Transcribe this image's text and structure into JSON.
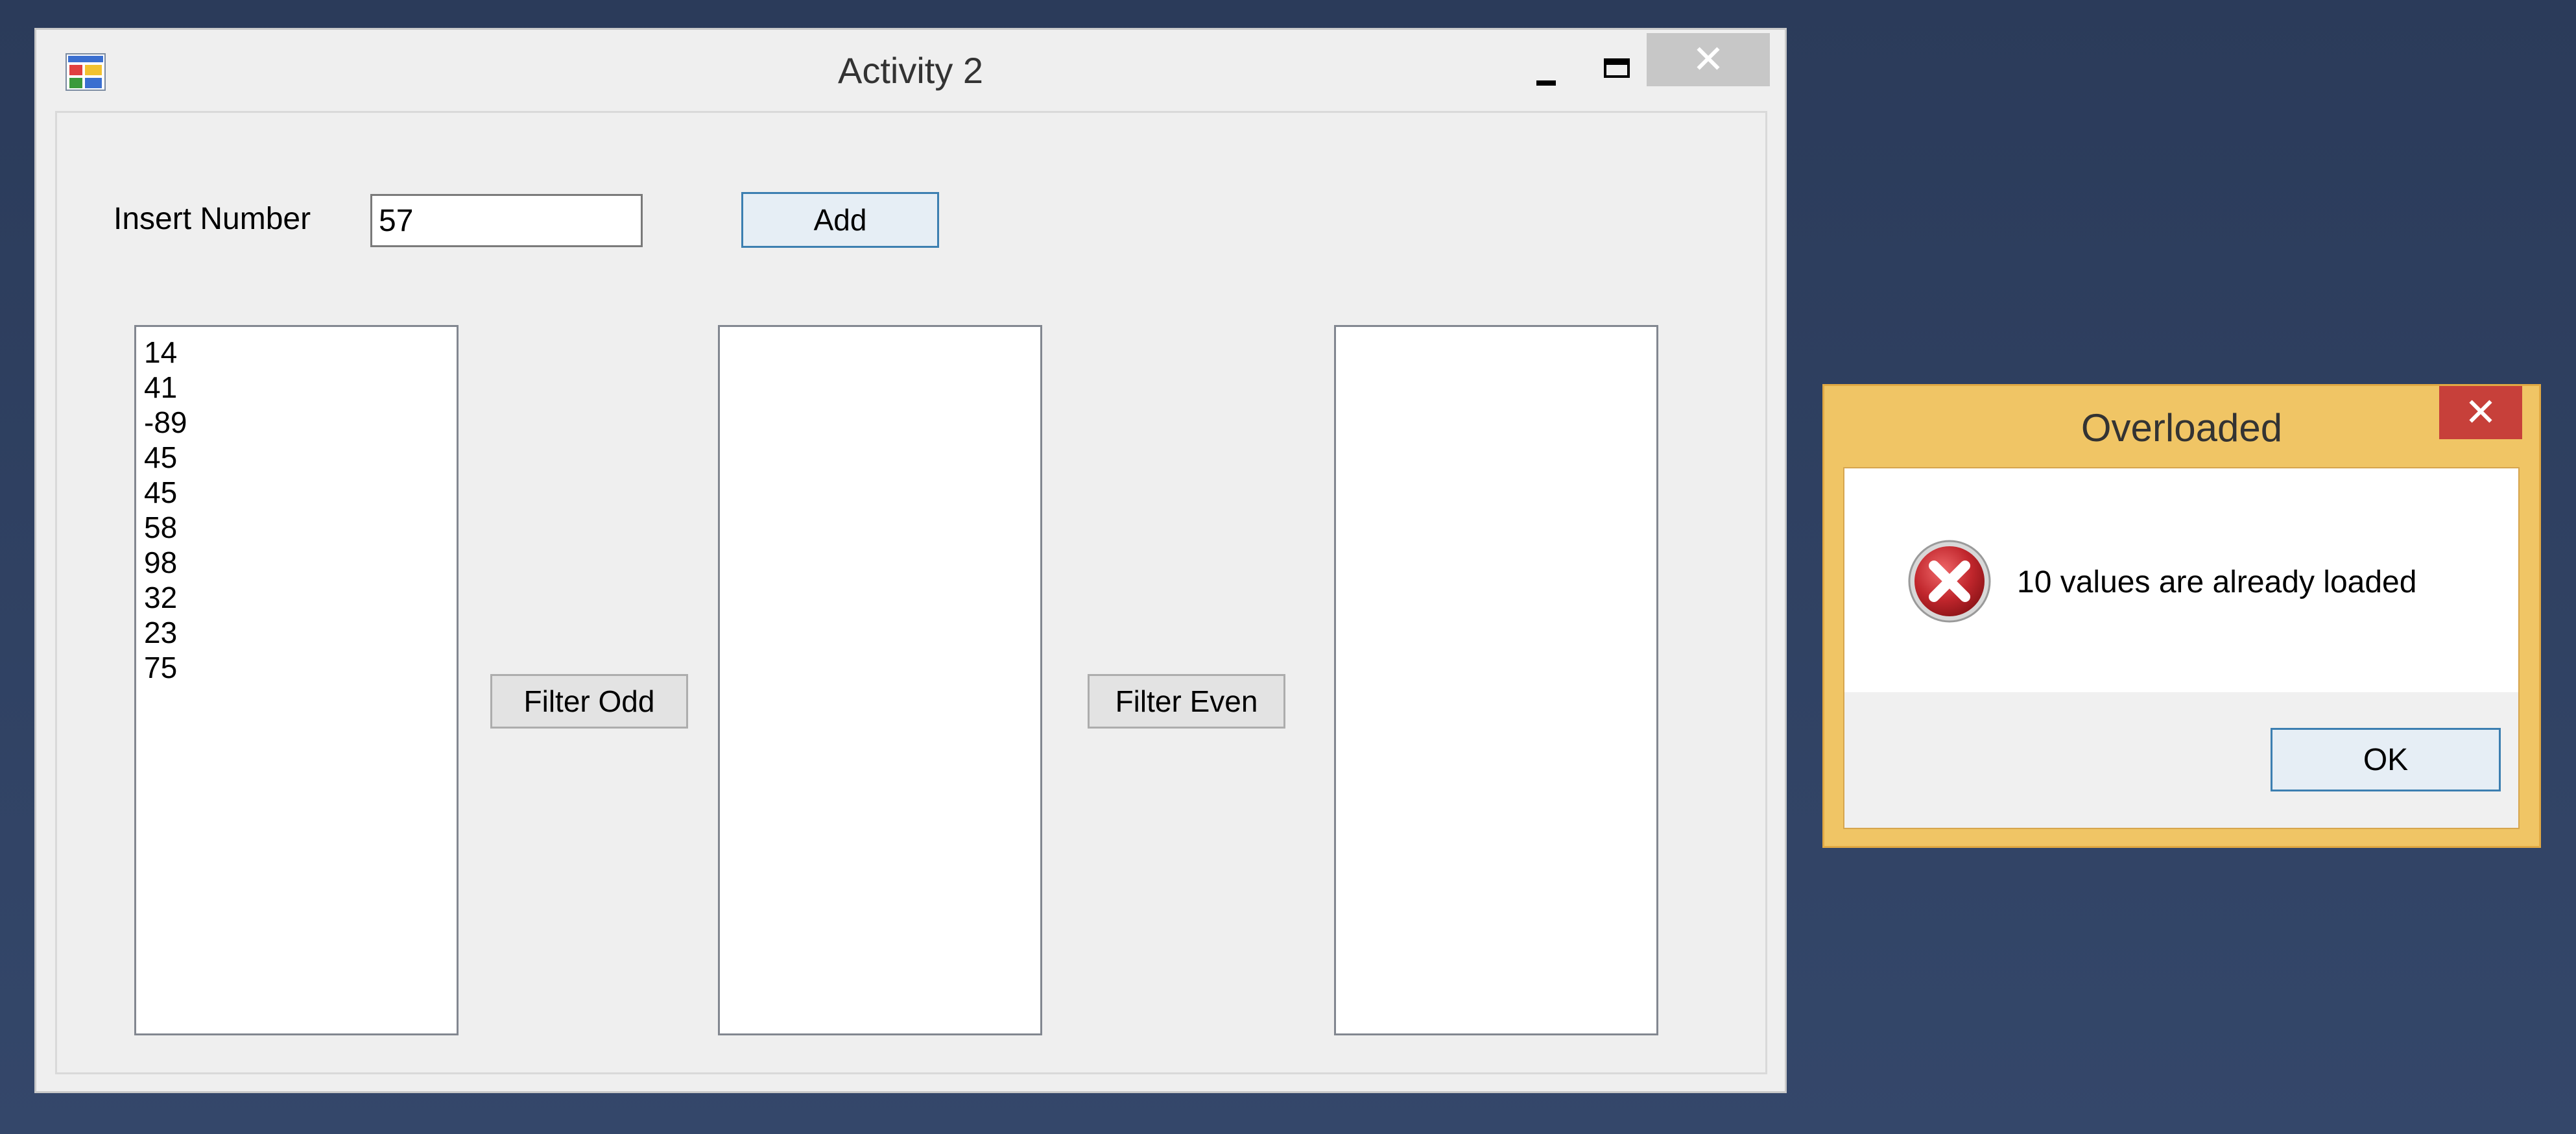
{
  "main_window": {
    "title": "Activity 2",
    "close_glyph": "✕",
    "icon": "app-icon",
    "insert_label": "Insert Number",
    "insert_value": "57",
    "add_label": "Add",
    "filter_odd_label": "Filter Odd",
    "filter_even_label": "Filter Even",
    "source_list": [
      "14",
      "41",
      "-89",
      "45",
      "45",
      "58",
      "98",
      "32",
      "23",
      "75"
    ],
    "odd_list": [],
    "even_list": []
  },
  "dialog": {
    "title": "Overloaded",
    "close_glyph": "✕",
    "icon": "error-icon",
    "message": "10 values are already loaded",
    "ok_label": "OK"
  },
  "colors": {
    "desktop": "#2b3b5a",
    "dialog_frame": "#f0c565",
    "dialog_close": "#c7403a",
    "error_red": "#c0262c"
  }
}
